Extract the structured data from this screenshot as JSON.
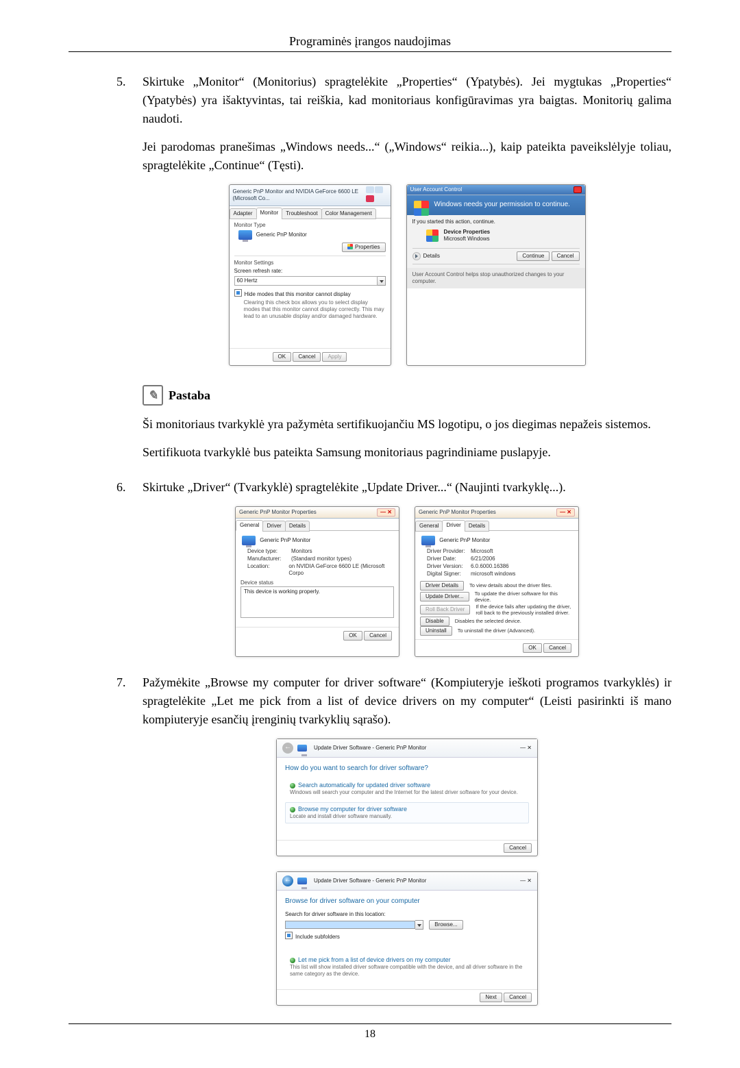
{
  "header": "Programinės įrangos naudojimas",
  "page_number": "18",
  "step5": {
    "num": "5.",
    "text": "Skirtuke „Monitor“ (Monitorius) spragtelėkite „Properties“ (Ypatybės). Jei mygtukas „Properties“ (Ypatybės) yra išaktyvintas, tai reiškia, kad monitoriaus konfigūravimas yra baigtas. Monitorių galima naudoti.",
    "para": "Jei parodomas pranešimas „Windows needs...“ („Windows“ reikia...), kaip pateikta paveikslėlyje toliau, spragtelėkite „Continue“ (Tęsti).",
    "note_label": "Pastaba",
    "note_icon_glyph": "✎",
    "note_p1": "Ši monitoriaus tvarkyklė yra pažymėta sertifikuojančiu MS logotipu, o jos diegimas nepažeis sistemos.",
    "note_p2": "Sertifikuota tvarkyklė bus pateikta Samsung monitoriaus pagrindiniame puslapyje."
  },
  "step6": {
    "num": "6.",
    "text": "Skirtuke „Driver“ (Tvarkyklė) spragtelėkite „Update Driver...“ (Naujinti tvarkyklę...)."
  },
  "step7": {
    "num": "7.",
    "text": "Pažymėkite „Browse my computer for driver software“ (Kompiuteryje ieškoti programos tvarkyklės) ir spragtelėkite „Let me pick from a list of device drivers on my computer“ (Leisti pasirinkti iš mano kompiuteryje esančių įrenginių tvarkyklių sąrašo)."
  },
  "fig1": {
    "title": "Generic PnP Monitor and NVIDIA GeForce 6600 LE (Microsoft Co...",
    "tabs": {
      "adapter": "Adapter",
      "monitor": "Monitor",
      "troubleshoot": "Troubleshoot",
      "color": "Color Management"
    },
    "monitor_type_label": "Monitor Type",
    "monitor_name": "Generic PnP Monitor",
    "properties_btn": "Properties",
    "monitor_settings_label": "Monitor Settings",
    "refresh_label": "Screen refresh rate:",
    "refresh_value": "60 Hertz",
    "hide_modes_cb": "Hide modes that this monitor cannot display",
    "hide_modes_desc": "Clearing this check box allows you to select display modes that this monitor cannot display correctly. This may lead to an unusable display and/or damaged hardware.",
    "ok": "OK",
    "cancel": "Cancel",
    "apply": "Apply"
  },
  "fig2": {
    "title": "User Account Control",
    "headline": "Windows needs your permission to continue.",
    "started": "If you started this action, continue.",
    "app_name": "Device Properties",
    "publisher": "Microsoft Windows",
    "details": "Details",
    "continue": "Continue",
    "cancel": "Cancel",
    "foot": "User Account Control helps stop unauthorized changes to your computer."
  },
  "fig3": {
    "title": "Generic PnP Monitor Properties",
    "tabs": {
      "general": "General",
      "driver": "Driver",
      "details": "Details"
    },
    "name": "Generic PnP Monitor",
    "rows": {
      "devtype_k": "Device type:",
      "devtype_v": "Monitors",
      "manu_k": "Manufacturer:",
      "manu_v": "(Standard monitor types)",
      "loc_k": "Location:",
      "loc_v": "on NVIDIA GeForce 6600 LE (Microsoft Corpo"
    },
    "status_label": "Device status",
    "status_text": "This device is working properly.",
    "ok": "OK",
    "cancel": "Cancel"
  },
  "fig4": {
    "title": "Generic PnP Monitor Properties",
    "tabs": {
      "general": "General",
      "driver": "Driver",
      "details": "Details"
    },
    "name": "Generic PnP Monitor",
    "rows": {
      "provider_k": "Driver Provider:",
      "provider_v": "Microsoft",
      "date_k": "Driver Date:",
      "date_v": "6/21/2006",
      "ver_k": "Driver Version:",
      "ver_v": "6.0.6000.16386",
      "signer_k": "Digital Signer:",
      "signer_v": "microsoft windows"
    },
    "btns": {
      "details": "Driver Details",
      "details_d": "To view details about the driver files.",
      "update": "Update Driver...",
      "update_d": "To update the driver software for this device.",
      "roll": "Roll Back Driver",
      "roll_d": "If the device fails after updating the driver, roll back to the previously installed driver.",
      "disable": "Disable",
      "disable_d": "Disables the selected device.",
      "uninst": "Uninstall",
      "uninst_d": "To uninstall the driver (Advanced)."
    },
    "ok": "OK",
    "cancel": "Cancel"
  },
  "fig5": {
    "title": "Update Driver Software - Generic PnP Monitor",
    "h": "How do you want to search for driver software?",
    "opt1_t": "Search automatically for updated driver software",
    "opt1_d": "Windows will search your computer and the Internet for the latest driver software for your device.",
    "opt2_t": "Browse my computer for driver software",
    "opt2_d": "Locate and install driver software manually.",
    "cancel": "Cancel"
  },
  "fig6": {
    "title": "Update Driver Software - Generic PnP Monitor",
    "h": "Browse for driver software on your computer",
    "search_label": "Search for driver software in this location:",
    "browse_btn": "Browse...",
    "include_sub": "Include subfolders",
    "opt_t": "Let me pick from a list of device drivers on my computer",
    "opt_d": "This list will show installed driver software compatible with the device, and all driver software in the same category as the device.",
    "next": "Next",
    "cancel": "Cancel"
  }
}
